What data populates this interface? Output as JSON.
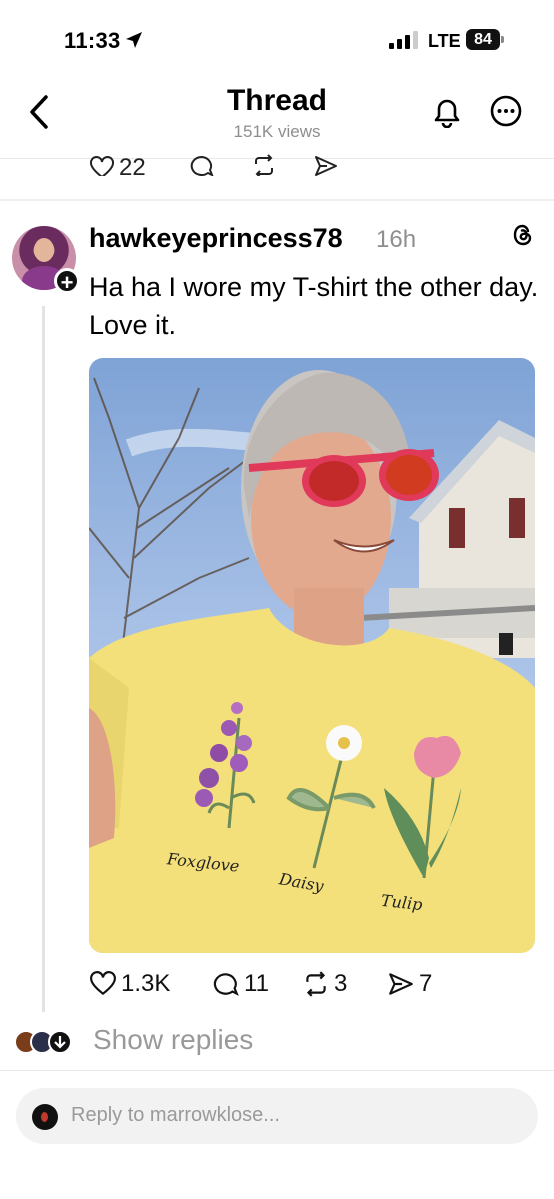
{
  "status_bar": {
    "time": "11:33",
    "network": "LTE",
    "battery": "84"
  },
  "header": {
    "title": "Thread",
    "views": "151K views"
  },
  "previous_post": {
    "likes": "22"
  },
  "post": {
    "username": "hawkeyeprincess78",
    "timestamp": "16h",
    "text": "Ha ha I wore my T-shirt the other day. Love it.",
    "shirt_labels": [
      "Foxglove",
      "Daisy",
      "Tulip"
    ],
    "likes": "1.3K",
    "replies": "11",
    "reposts": "3",
    "shares": "7"
  },
  "show_replies": "Show replies",
  "reply_box": {
    "placeholder": "Reply to marrowklose..."
  },
  "colors": {
    "accent": "#000000",
    "muted": "#8e8e8e",
    "shirt": "#f4e07a",
    "glasses": "#e0395a"
  },
  "icons": [
    "location-arrow-icon",
    "signal-icon",
    "battery-icon",
    "back-chevron-icon",
    "bell-icon",
    "more-icon",
    "heart-icon",
    "comment-icon",
    "repost-icon",
    "share-icon",
    "threads-logo-icon",
    "follow-plus-icon"
  ]
}
